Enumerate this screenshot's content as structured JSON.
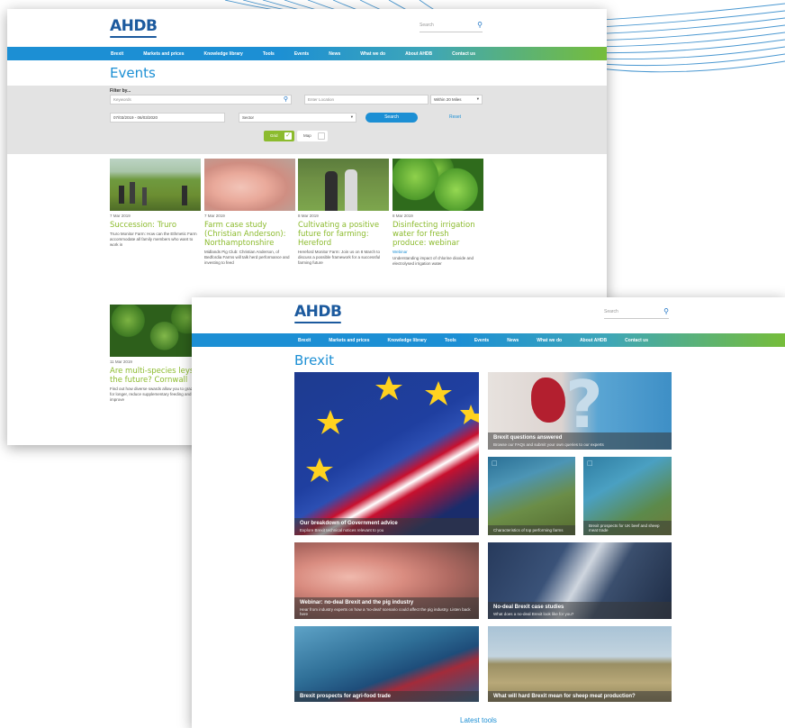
{
  "colors": {
    "brand_blue": "#1c5a9e",
    "accent_blue": "#1c8fd4",
    "accent_green": "#8cbb2e",
    "filter_gray": "#e3e3e3"
  },
  "events_page": {
    "logo": "AHDB",
    "search_placeholder": "Search",
    "nav": [
      "Brexit",
      "Markets and prices",
      "Knowledge library",
      "Tools",
      "Events",
      "News",
      "What we do",
      "About AHDB",
      "Contact us"
    ],
    "title": "Events",
    "filter": {
      "label": "Filter by...",
      "keywords_placeholder": "Keywords",
      "location_placeholder": "Enter Location",
      "distance_value": "Within 20 Miles",
      "date_range": "07/03/2019 - 06/03/2020",
      "sector_value": "Sector",
      "search_button": "Search",
      "reset_link": "Reset",
      "view_grid": "Grid",
      "view_map": "Map"
    },
    "cards": [
      {
        "date": "7 Mar 2019",
        "title": "Succession: Truro",
        "desc": "Truro Monitor Farm: How can the Ethmetic Farm accommodate all family members who want to work in",
        "more": "",
        "tag": "",
        "image": "farmers-in-field"
      },
      {
        "date": "7 Mar 2019",
        "title": "Farm case study (Christian Anderson): Northamptonshire",
        "desc": "Midlands Pig Club: Christian Anderson, of Bedfordia Farms will talk herd performance and investing to feed",
        "more": "",
        "tag": "",
        "image": "pig"
      },
      {
        "date": "8 Mar 2019",
        "title": "Cultivating a positive future for farming: Hereford",
        "desc": "Hereford Monitor Farm: Join us on 8 March to discuss a possible framework for a successful farming future",
        "more": "",
        "tag": "",
        "image": "two-farmers"
      },
      {
        "date": "8 Mar 2019",
        "title": "Disinfecting irrigation water for fresh produce: webinar",
        "desc": "Understanding impact of chlorine dioxide and electrolysed irrigation water",
        "more": "",
        "tag": "Webinar",
        "image": "lettuce"
      },
      {
        "date": "11 Mar 2019",
        "title": "Are multi-species leys the future? Cornwall",
        "desc": "Find out how diverse swards allow you to graze for longer, reduce supplementary feeding and improve",
        "more": "",
        "tag": "",
        "image": "leys"
      }
    ]
  },
  "brexit_page": {
    "logo": "AHDB",
    "search_placeholder": "Search",
    "nav": [
      "Brexit",
      "Markets and prices",
      "Knowledge library",
      "Tools",
      "Events",
      "News",
      "What we do",
      "About AHDB",
      "Contact us"
    ],
    "title": "Brexit",
    "tiles": {
      "govt": {
        "heading": "Our breakdown of Government advice",
        "sub": "Explore Brexit technical notices relevant to you",
        "image": "eu-uk-flags"
      },
      "questions": {
        "heading": "Brexit questions answered",
        "sub": "Browse our FAQs and submit your own queries to our experts",
        "image": "uk-map-question"
      },
      "horizon1": {
        "heading": "Characteristics of top performing farms",
        "sub": "",
        "image": "horizon-report"
      },
      "horizon2": {
        "heading": "Brexit prospects for UK beef and sheep meat trade",
        "sub": "",
        "image": "horizon-report"
      },
      "pig": {
        "heading": "Webinar: no-deal Brexit and the pig industry",
        "sub": "Hear from industry experts on how a 'no-deal' scenario could affect the pig industry. Listen back here",
        "image": "piglets"
      },
      "casestudies": {
        "heading": "No-deal Brexit case studies",
        "sub": "What does a no-deal Brexit look like for you?",
        "image": "calf-feeding"
      },
      "agrifood": {
        "heading": "Brexit prospects for agri-food trade",
        "sub": "",
        "image": "map-report"
      },
      "sheep": {
        "heading": "What will hard Brexit mean for sheep meat production?",
        "sub": "",
        "image": "sheep-field"
      }
    },
    "latest_tools": "Latest tools"
  }
}
